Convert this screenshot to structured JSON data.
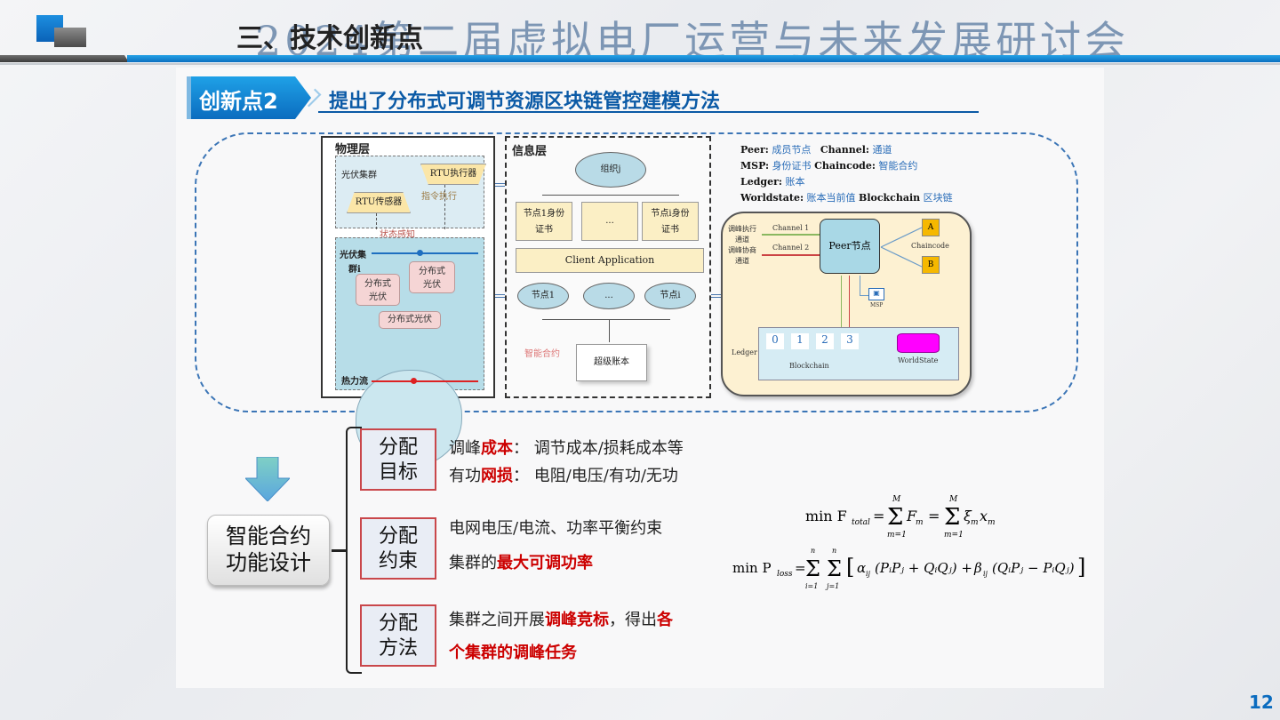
{
  "header": {
    "watermark": "2024第二届虚拟电厂运营与未来发展研讨会",
    "section_title": "三、技术创新点"
  },
  "badge": {
    "label": "创新点2"
  },
  "subtitle": "提出了分布式可调节资源区块链管控建模方法",
  "diagram": {
    "physical_layer": {
      "title": "物理层",
      "pv_cluster_label": "光伏集群",
      "rtu_executor": "RTU执行器",
      "rtu_sensor": "RTU传感器",
      "command_exec": "指令执行",
      "state_sense": "状态感知",
      "pv_cluster_i": [
        "光伏集",
        "群i"
      ],
      "dist_pv_1": [
        "分布式",
        "光伏"
      ],
      "dist_pv_2": [
        "分布式",
        "光伏"
      ],
      "dist_pv_3": "分布式光伏",
      "heat_flow": "热力流"
    },
    "info_layer": {
      "title": "信息层",
      "org": "组织j",
      "cert1": [
        "节点1身份",
        "证书"
      ],
      "cert_dots": "...",
      "certi": [
        "节点i身份",
        "证书"
      ],
      "client_app": "Client Application",
      "node1": "节点1",
      "node_dots": "...",
      "nodei": "节点i",
      "smart_contract": "智能合约",
      "super_ledger": "超级账本"
    },
    "legend": [
      {
        "term": "Peer:",
        "cn": "成员节点",
        "term2": "Channel:",
        "cn2": "通道"
      },
      {
        "term": "MSP:",
        "cn": "身份证书",
        "term2": "Chaincode:",
        "cn2": "智能合约"
      },
      {
        "term": "Ledger:",
        "cn": "账本",
        "term2": "",
        "cn2": ""
      },
      {
        "term": "Worldstate:",
        "cn": "账本当前值",
        "term2": "Blockchain",
        "cn2": "区块链"
      }
    ],
    "fabric": {
      "ch1_label": [
        "调峰执行",
        "通道"
      ],
      "ch2_label": [
        "调峰协商",
        "通道"
      ],
      "channel1": "Channel 1",
      "channel2": "Channel 2",
      "peer": "Peer节点",
      "chaincode_a": "A",
      "chaincode_b": "B",
      "chaincode": "Chaincode",
      "msp": "MSP",
      "ledger": "Ledger",
      "blocks": [
        "0",
        "1",
        "2",
        "3"
      ],
      "blockchain": "Blockchain",
      "worldstate": "WorldState"
    }
  },
  "design": {
    "title": [
      "智能合约",
      "功能设计"
    ],
    "items": [
      {
        "box": [
          "分配",
          "目标"
        ],
        "lines": [
          [
            {
              "t": "调峰",
              "red": false
            },
            {
              "t": "成本",
              "red": true
            },
            {
              "t": "：  调节成本/损耗成本等",
              "red": false
            }
          ],
          [
            {
              "t": "有功",
              "red": false
            },
            {
              "t": "网损",
              "red": true
            },
            {
              "t": "：  电阻/电压/有功/无功",
              "red": false
            }
          ]
        ]
      },
      {
        "box": [
          "分配",
          "约束"
        ],
        "lines": [
          [
            {
              "t": "电网电压/电流、功率平衡约束",
              "red": false
            }
          ],
          [
            {
              "t": "集群的",
              "red": false
            },
            {
              "t": "最大可调功率",
              "red": true
            }
          ]
        ]
      },
      {
        "box": [
          "分配",
          "方法"
        ],
        "lines": [
          [
            {
              "t": "集群之间开展",
              "red": false
            },
            {
              "t": "调峰竞标",
              "red": true
            },
            {
              "t": "，得出",
              "red": false
            },
            {
              "t": "各",
              "red": true
            }
          ],
          [
            {
              "t": "个集群的调峰任务",
              "red": true
            }
          ]
        ]
      }
    ]
  },
  "equations": {
    "eq1": "min F_total = Σ_{m=1}^{M} F_m = Σ_{m=1}^{M} ξ_m x_m",
    "eq2": "min P_loss = Σ_{i=1}^{n} Σ_{j=1}^{n} [ α_ij (P_i P_j + Q_i Q_j) + β_ij (Q_i P_j − P_i Q_j) ]"
  },
  "page_number": "12"
}
